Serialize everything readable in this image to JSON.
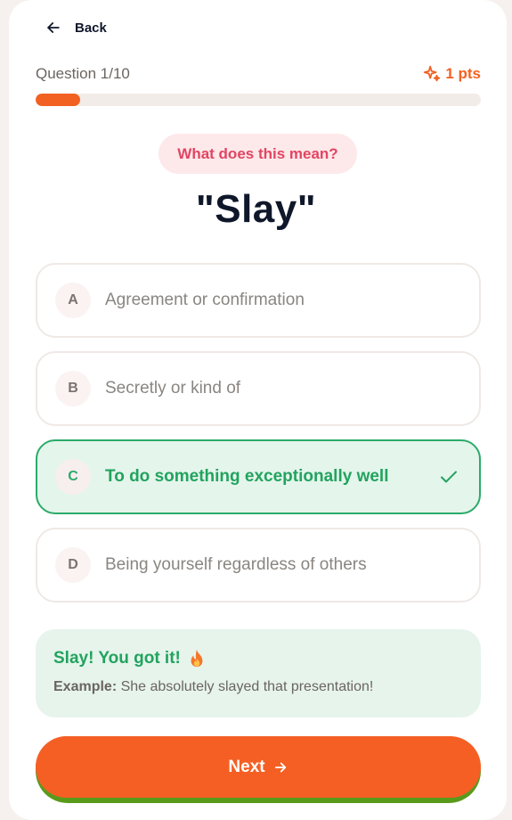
{
  "header": {
    "back_label": "Back"
  },
  "progress": {
    "question_label": "Question 1/10",
    "points_label": "1 pts",
    "fraction": 0.1
  },
  "question": {
    "prompt": "What does this mean?",
    "term": "\"Slay\""
  },
  "options": [
    {
      "letter": "A",
      "text": "Agreement or confirmation"
    },
    {
      "letter": "B",
      "text": "Secretly or kind of"
    },
    {
      "letter": "C",
      "text": "To do something exceptionally well",
      "selected_correct": true
    },
    {
      "letter": "D",
      "text": "Being yourself regardless of others"
    }
  ],
  "feedback": {
    "title": "Slay! You got it!",
    "example_label": "Example:",
    "example_text": "She absolutely slayed that presentation!",
    "icon": "fire-icon"
  },
  "next_button": {
    "label": "Next"
  },
  "colors": {
    "accent": "#f26122",
    "correct": "#22a35e",
    "pill_text": "#e24562"
  }
}
